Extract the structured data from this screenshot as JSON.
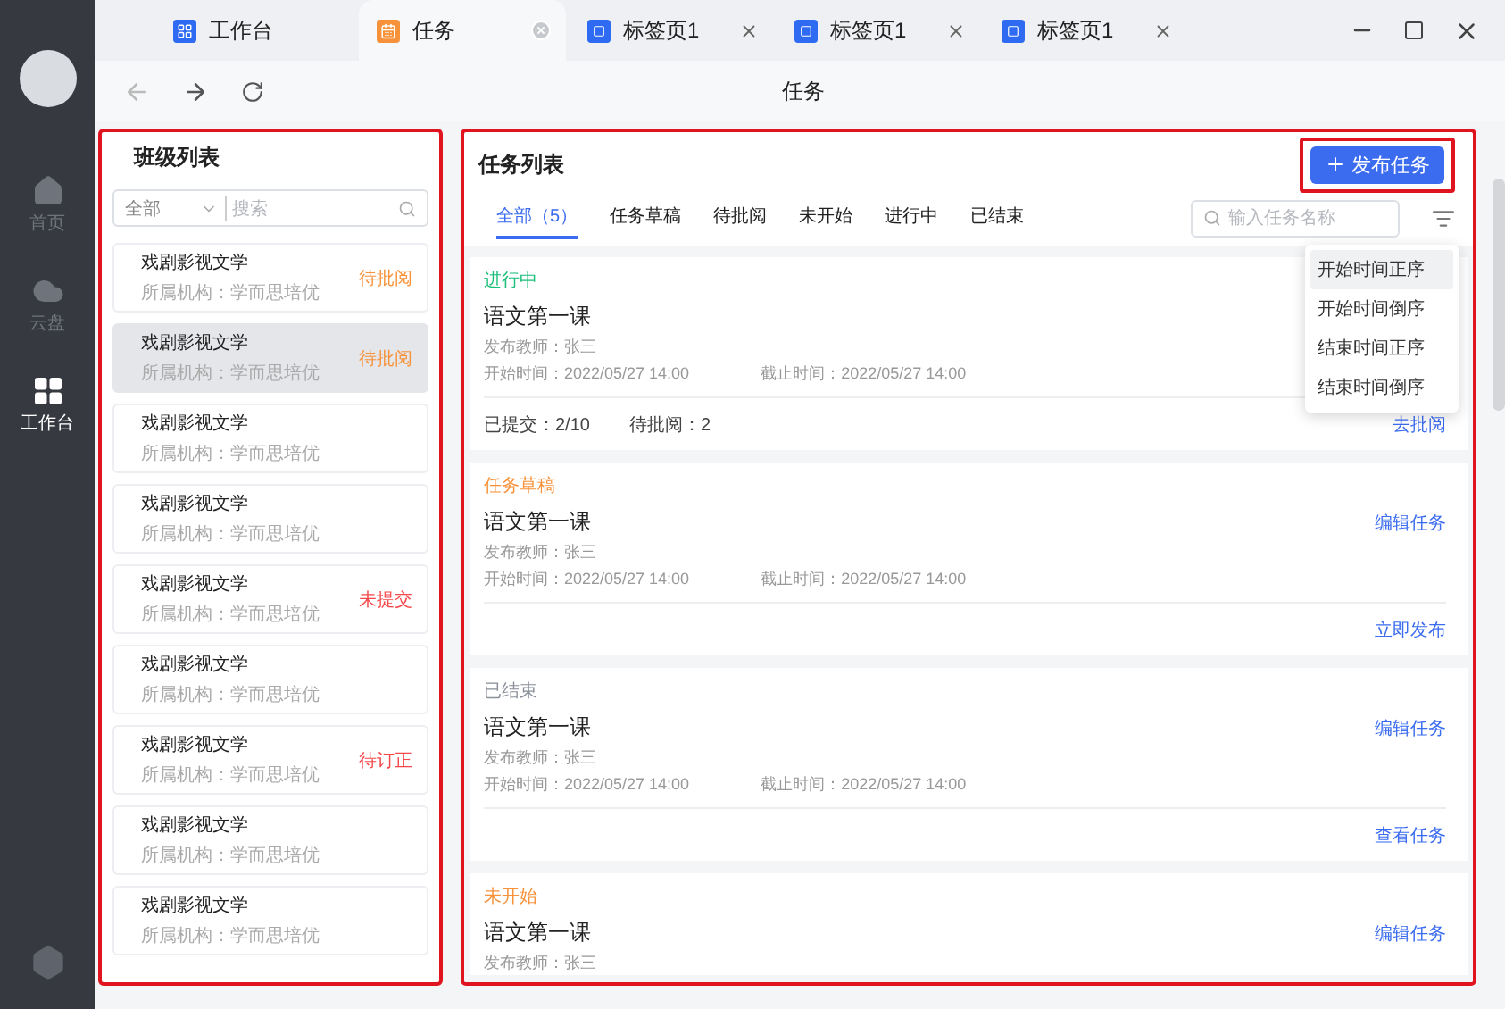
{
  "sidebar": {
    "items": [
      {
        "label": "首页",
        "selected": false
      },
      {
        "label": "云盘",
        "selected": false
      },
      {
        "label": "工作台",
        "selected": true
      }
    ]
  },
  "window_tabs": [
    {
      "label": "工作台",
      "selected": false
    },
    {
      "label": "任务",
      "selected": true
    },
    {
      "label": "标签页1",
      "selected": false
    },
    {
      "label": "标签页1",
      "selected": false
    },
    {
      "label": "标签页1",
      "selected": false
    }
  ],
  "page_title": "任务",
  "class_panel": {
    "title": "班级列表",
    "filter": "全部",
    "search_placeholder": "搜索",
    "items": [
      {
        "name": "戏剧影视文学",
        "org": "所属机构：学而思培优",
        "status": "待批阅",
        "color": "#f7923a",
        "selected": false
      },
      {
        "name": "戏剧影视文学",
        "org": "所属机构：学而思培优",
        "status": "待批阅",
        "color": "#f7923a",
        "selected": true
      },
      {
        "name": "戏剧影视文学",
        "org": "所属机构：学而思培优",
        "selected": false
      },
      {
        "name": "戏剧影视文学",
        "org": "所属机构：学而思培优",
        "selected": false
      },
      {
        "name": "戏剧影视文学",
        "org": "所属机构：学而思培优",
        "status": "未提交",
        "color": "#f5484b",
        "selected": false
      },
      {
        "name": "戏剧影视文学",
        "org": "所属机构：学而思培优",
        "selected": false
      },
      {
        "name": "戏剧影视文学",
        "org": "所属机构：学而思培优",
        "status": "待订正",
        "color": "#f5484b",
        "selected": false
      },
      {
        "name": "戏剧影视文学",
        "org": "所属机构：学而思培优",
        "selected": false
      },
      {
        "name": "戏剧影视文学",
        "org": "所属机构：学而思培优",
        "selected": false
      }
    ]
  },
  "task_panel": {
    "title": "任务列表",
    "publish_button": "发布任务",
    "search_placeholder": "输入任务名称",
    "tabs": [
      {
        "label": "全部（5）",
        "selected": true
      },
      {
        "label": "任务草稿",
        "selected": false
      },
      {
        "label": "待批阅",
        "selected": false
      },
      {
        "label": "未开始",
        "selected": false
      },
      {
        "label": "进行中",
        "selected": false
      },
      {
        "label": "已结束",
        "selected": false
      }
    ],
    "sort_menu": [
      {
        "label": "开始时间正序",
        "selected": true
      },
      {
        "label": "开始时间倒序",
        "selected": false
      },
      {
        "label": "结束时间正序",
        "selected": false
      },
      {
        "label": "结束时间倒序",
        "selected": false
      }
    ],
    "tasks": [
      {
        "status": "进行中",
        "color": "#1bbf7a",
        "title": "语文第一课",
        "teacher": "发布教师：张三",
        "start": "开始时间：2022/05/27 14:00",
        "end": "截止时间：2022/05/27 14:00",
        "stats": [
          "已提交：2/10",
          "待批阅：2"
        ],
        "bottom_action": "去批阅"
      },
      {
        "status": "任务草稿",
        "color": "#f7923a",
        "title": "语文第一课",
        "teacher": "发布教师：张三",
        "start": "开始时间：2022/05/27 14:00",
        "end": "截止时间：2022/05/27 14:00",
        "top_action": "编辑任务",
        "bottom_action": "立即发布"
      },
      {
        "status": "已结束",
        "color": "#8a8f99",
        "title": "语文第一课",
        "teacher": "发布教师：张三",
        "start": "开始时间：2022/05/27 14:00",
        "end": "截止时间：2022/05/27 14:00",
        "top_action": "编辑任务",
        "bottom_action": "查看任务"
      },
      {
        "status": "未开始",
        "color": "#f7923a",
        "title": "语文第一课",
        "teacher": "发布教师：张三",
        "top_action": "编辑任务"
      }
    ]
  }
}
